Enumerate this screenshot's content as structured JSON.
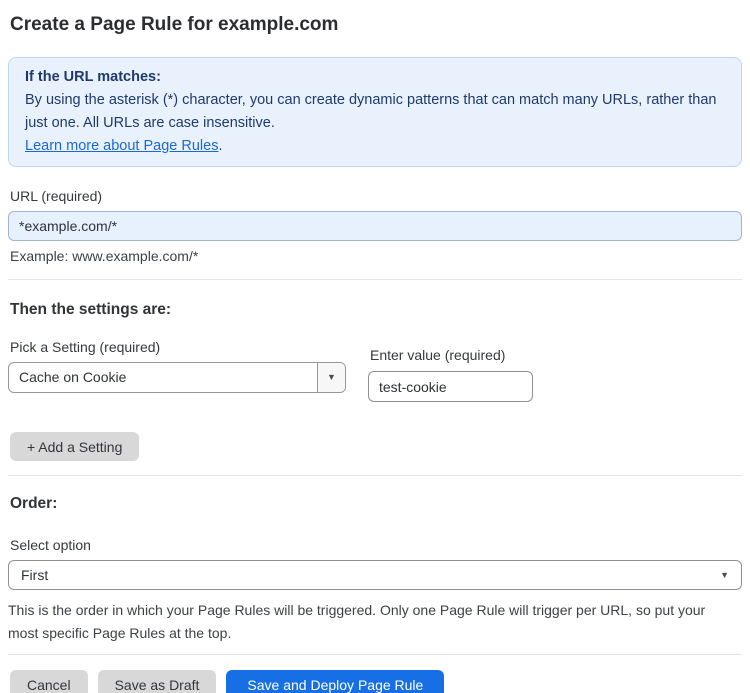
{
  "page": {
    "title": "Create a Page Rule for example.com"
  },
  "info_box": {
    "heading": "If the URL matches:",
    "body": "By using the asterisk (*) character, you can create dynamic patterns that can match many URLs, rather than just one. All URLs are case insensitive.",
    "link_label": "Learn more about Page Rules",
    "link_suffix": "."
  },
  "url_field": {
    "label": "URL (required)",
    "value": "*example.com/*",
    "helper": "Example: www.example.com/*"
  },
  "settings_section": {
    "heading": "Then the settings are:",
    "setting_label": "Pick a Setting (required)",
    "setting_value": "Cache on Cookie",
    "value_label": "Enter value (required)",
    "value_value": "test-cookie",
    "add_button_label": "+ Add a Setting",
    "dropdown_arrow": "▼"
  },
  "order_section": {
    "heading": "Order:",
    "select_label": "Select option",
    "select_value": "First",
    "dropdown_arrow": "▼",
    "helper": "This is the order in which your Page Rules will be triggered. Only one Page Rule will trigger per URL, so put your most specific Page Rules at the top."
  },
  "footer": {
    "cancel_label": "Cancel",
    "save_draft_label": "Save as Draft",
    "save_deploy_label": "Save and Deploy Page Rule"
  },
  "colors": {
    "info_bg": "#e9f2fc",
    "info_border": "#bcd9f4",
    "info_text": "#1e3a6d",
    "link": "#1b68d5",
    "url_input_bg": "#e7f0fd",
    "primary_button": "#166fe5",
    "gray_button": "#d8d8d8"
  }
}
